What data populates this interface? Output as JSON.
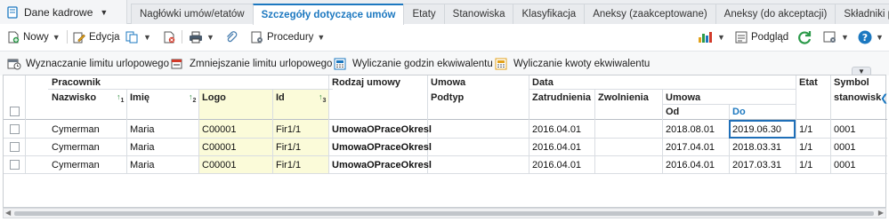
{
  "module_selector": {
    "label": "Dane kadrowe",
    "icon": "book-icon"
  },
  "tabs": [
    "Nagłówki umów/etatów",
    "Szczegóły dotyczące umów",
    "Etaty",
    "Stanowiska",
    "Klasyfikacja",
    "Aneksy (zaakceptowane)",
    "Aneksy (do akceptacji)",
    "Składniki p"
  ],
  "active_tab_index": 1,
  "toolbar": {
    "new_label": "Nowy",
    "edit_label": "Edycja",
    "procedures_label": "Procedury",
    "preview_label": "Podgląd"
  },
  "actions": {
    "a1": "Wyznaczanie limitu urlopowego",
    "a2": "Zmniejszanie limitu urlopowego",
    "a3": "Wyliczanie godzin ekwiwalentu",
    "a4": "Wyliczanie kwoty ekwiwalentu"
  },
  "headers": {
    "pracownik": "Pracownik",
    "nazwisko": "Nazwisko",
    "imie": "Imię",
    "logo": "Logo",
    "id": "Id",
    "rodzaj_umowy": "Rodzaj umowy",
    "umowa": "Umowa",
    "podtyp": "Podtyp",
    "data": "Data",
    "zatrudnienia": "Zatrudnienia",
    "zwolnienia": "Zwolnienia",
    "umowa2": "Umowa",
    "od": "Od",
    "do": "Do",
    "etat": "Etat",
    "symbol": "Symbol",
    "stanowisko": "stanowisk"
  },
  "sort_indices": {
    "nazwisko": "1",
    "imie": "2",
    "id": "3"
  },
  "rows": [
    {
      "nazwisko": "Cymerman",
      "imie": "Maria",
      "logo": "C00001",
      "id": "Fir1/1",
      "rodzaj": "UmowaOPraceOkresl",
      "zatr": "2016.04.01",
      "zwol": "",
      "od": "2018.08.01",
      "do": "2019.06.30",
      "etat": "1/1",
      "symbol": "0001"
    },
    {
      "nazwisko": "Cymerman",
      "imie": "Maria",
      "logo": "C00001",
      "id": "Fir1/1",
      "rodzaj": "UmowaOPraceOkresl",
      "zatr": "2016.04.01",
      "zwol": "",
      "od": "2017.04.01",
      "do": "2018.03.31",
      "etat": "1/1",
      "symbol": "0001"
    },
    {
      "nazwisko": "Cymerman",
      "imie": "Maria",
      "logo": "C00001",
      "id": "Fir1/1",
      "rodzaj": "UmowaOPraceOkresl",
      "zatr": "2016.04.01",
      "zwol": "",
      "od": "2016.04.01",
      "do": "2017.03.31",
      "etat": "1/1",
      "symbol": "0001"
    }
  ],
  "colors": {
    "accent": "#1c78c0",
    "yellow_highlight": "#fbfbd9",
    "refresh_green": "#2c9a4a"
  }
}
